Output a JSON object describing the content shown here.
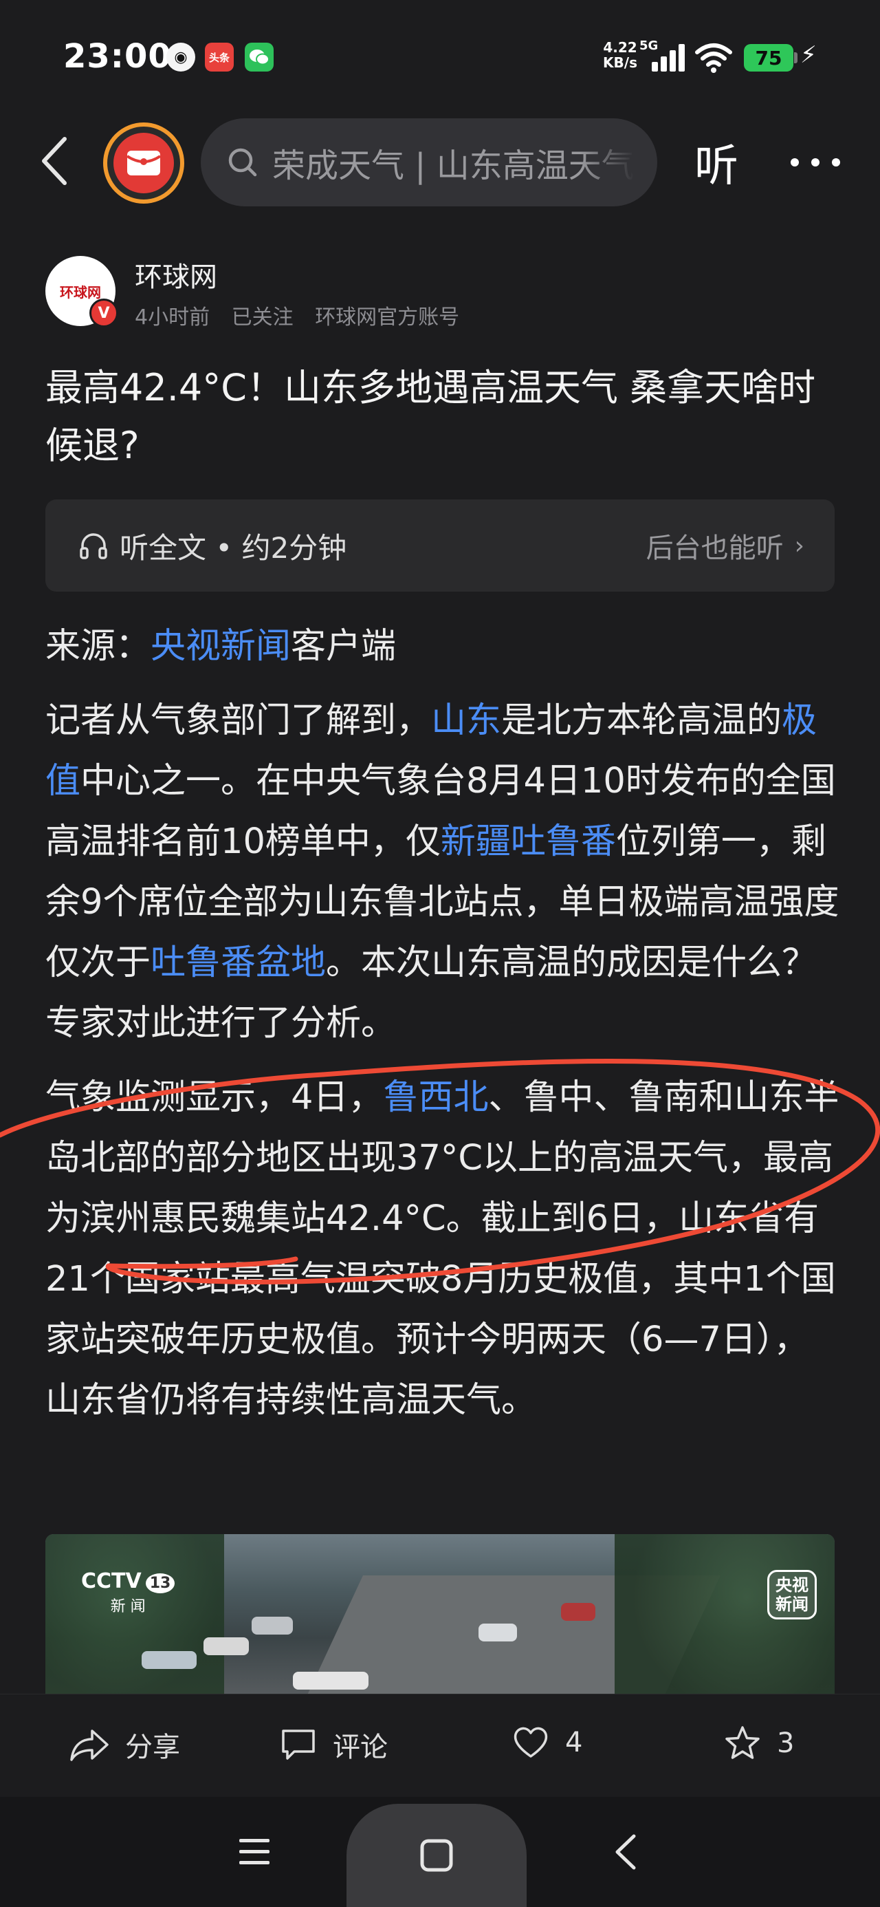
{
  "status_bar": {
    "time": "23:00",
    "apps": [
      "qq-icon",
      "toutiao-icon",
      "wechat-icon"
    ],
    "toutiao_label": "头条",
    "net_speed_value": "4.22",
    "net_speed_unit": "KB/s",
    "network": "5G",
    "battery": "75"
  },
  "nav": {
    "search_text": "荣成天气 | 山东高温天气",
    "listen_label": "听"
  },
  "author": {
    "name": "环球网",
    "avatar_text": "环球网",
    "time_ago": "4小时前",
    "follow_status": "已关注",
    "account_type": "环球网官方账号"
  },
  "article": {
    "title": "最高42.4°C！山东多地遇高温天气 桑拿天啥时候退?",
    "listen_bar": {
      "left_label": "听全文 • 约2分钟",
      "right_label": "后台也能听"
    },
    "source_prefix": "来源：",
    "source_link": "央视新闻",
    "source_suffix": "客户端",
    "p1": {
      "t1": "记者从气象部门了解到，",
      "l1": "山东",
      "t2": "是北方本轮高温的",
      "l2": "极值",
      "t3": "中心之一。在中央气象台8月4日10时发布的全国高温排名前10榜单中，仅",
      "l3": "新疆吐鲁番",
      "t4": "位列第一，剩余9个席位全部为山东鲁北站点，单日极端高温强度仅次于",
      "l4": "吐鲁番盆地",
      "t5": "。本次山东高温的成因是什么？专家对此进行了分析。"
    },
    "p2": {
      "t1": "气象监测显示，4日，",
      "l1": "鲁西北",
      "t2": "、鲁中、鲁南和山东半岛北部的部分地区出现37°C以上的高温天气，最高为滨州惠民魏集站42.4°C。截止到6日，山东省有21个国家站最高气温突破8月历史极值，其中1个国家站突破年历史极值。预计今明两天（6—7日），山东省仍将有持续性高温天气。"
    },
    "video": {
      "channel_logo": "CCTV",
      "channel_number": "13",
      "channel_sub": "新 闻",
      "watermark_line1": "央视",
      "watermark_line2": "新闻"
    }
  },
  "actions": {
    "share": "分享",
    "comment": "评论",
    "likes": "4",
    "favorites": "3"
  },
  "colors": {
    "background": "#1c1c1e",
    "link": "#4b8df6",
    "annotation": "#ee4a35",
    "battery": "#2ec759"
  }
}
